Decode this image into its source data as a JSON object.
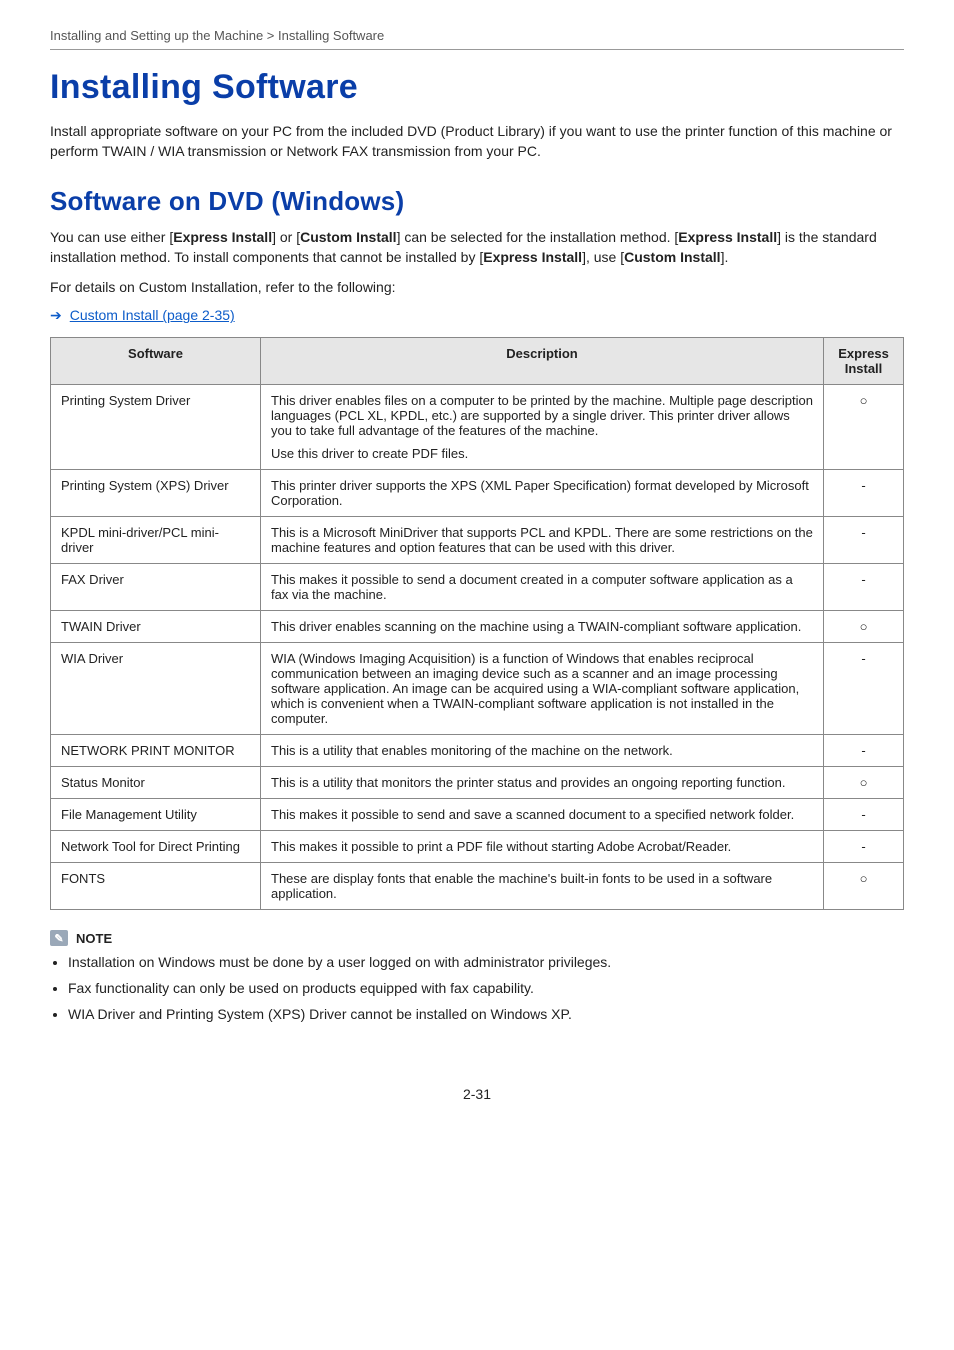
{
  "breadcrumb": "Installing and Setting up the Machine > Installing Software",
  "main_heading": "Installing Software",
  "intro_para": "Install appropriate software on your PC from the included DVD (Product Library) if you want to use the printer function of this machine or perform TWAIN / WIA transmission or Network FAX transmission from your PC.",
  "sub_heading": "Software on DVD (Windows)",
  "sub_para_pre": "You can use either [",
  "sub_para_b1": "Express Install",
  "sub_para_mid1": "] or [",
  "sub_para_b2": "Custom Install",
  "sub_para_mid2": "] can be selected for the installation method. [",
  "sub_para_b3": "Express Install",
  "sub_para_mid3": "] is the standard installation method. To install components that cannot be installed by [",
  "sub_para_b4": "Express Install",
  "sub_para_mid4": "], use [",
  "sub_para_b5": "Custom Install",
  "sub_para_post": "].",
  "details_line": "For details on Custom Installation, refer to the following:",
  "ref_link": "Custom Install (page 2-35)",
  "table": {
    "headers": {
      "software": "Software",
      "description": "Description",
      "express": "Express Install"
    },
    "rows": [
      {
        "software": "Printing System Driver",
        "description": "This driver enables files on a computer to be printed by the machine. Multiple page description languages (PCL XL, KPDL, etc.) are supported by a single driver. This printer driver allows you to take full advantage of the features of the machine.",
        "description_extra": "Use this driver to create PDF files.",
        "express": "○"
      },
      {
        "software": "Printing System (XPS) Driver",
        "description": "This printer driver supports the XPS (XML Paper Specification) format developed by Microsoft Corporation.",
        "express": "-"
      },
      {
        "software": "KPDL mini-driver/PCL mini-driver",
        "description": "This is a Microsoft MiniDriver that supports PCL and KPDL. There are some restrictions on the machine features and option features that can be used with this driver.",
        "express": "-"
      },
      {
        "software": "FAX Driver",
        "description": "This makes it possible to send a document created in a computer software application as a fax via the machine.",
        "express": "-"
      },
      {
        "software": "TWAIN Driver",
        "description": "This driver enables scanning on the machine using a TWAIN-compliant software application.",
        "express": "○"
      },
      {
        "software": "WIA Driver",
        "description": "WIA (Windows Imaging Acquisition) is a function of Windows that enables reciprocal communication between an imaging device such as a scanner and an image processing software application. An image can be acquired using a WIA-compliant software application, which is convenient when a TWAIN-compliant software application is not installed in the computer.",
        "express": "-"
      },
      {
        "software": "NETWORK PRINT MONITOR",
        "description": "This is a utility that enables monitoring of the machine on the network.",
        "express": "-"
      },
      {
        "software": "Status Monitor",
        "description": "This is a utility that monitors the printer status and provides an ongoing reporting function.",
        "express": "○"
      },
      {
        "software": "File Management Utility",
        "description": "This makes it possible to send and save a scanned document to a specified network folder.",
        "express": "-"
      },
      {
        "software": "Network Tool for Direct Printing",
        "description": "This makes it possible to print a PDF file without starting Adobe Acrobat/Reader.",
        "express": "-"
      },
      {
        "software": "FONTS",
        "description": "These are display fonts that enable the machine's built-in fonts to be used in a software application.",
        "express": "○"
      }
    ]
  },
  "note": {
    "label": "NOTE",
    "items": [
      "Installation on Windows must be done by a user logged on with administrator privileges.",
      "Fax functionality can only be used on products equipped with fax capability.",
      "WIA Driver and Printing System (XPS) Driver cannot be installed on Windows XP."
    ]
  },
  "page_number": "2-31"
}
